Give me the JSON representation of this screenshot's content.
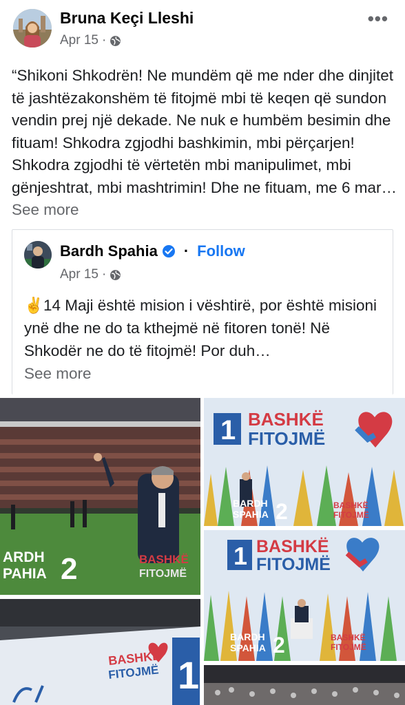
{
  "post": {
    "author": "Bruna Keçi Lleshi",
    "date": "Apr 15",
    "sep": "·",
    "more_icon": "•••",
    "text": "“Shikoni Shkodrën! Ne mundëm që me nder dhe dinjitet të jashtëzakonshëm të fitojmë mbi të keqen që sundon vendin prej një dekade. Ne nuk e humbëm besimin dhe fituam! Shkodra zgjodhi bashkimin, mbi përçarjen! Shkodra zgjodhi të vërtetën mbi manipulimet, mbi gënjeshtrat, mbi mashtrimin! Dhe ne fituam, me 6 mar… ",
    "see_more": "See more"
  },
  "shared": {
    "author": "Bardh Spahia",
    "dot": "·",
    "follow": "Follow",
    "date": "Apr 15",
    "sep": "·",
    "text": "✌️14 Maji është mision i vështirë, por është misioni ynë dhe ne do ta kthejmë në fitoren tonë! Në Shkodër ne do të fitojmë! Por duh…",
    "see_more": "See more"
  },
  "photos": {
    "campaign_name_1": "BARDH",
    "campaign_name_2": "SPAHIA",
    "campaign_number": "2",
    "slogan_1": "BASHKË",
    "slogan_2": "FITOJMË",
    "list_number": "1",
    "photo1_name_1": "ARDH",
    "photo1_name_2": "PAHIA",
    "photo1_slogan_1": "BASHKË",
    "photo1_slogan_2": "FITOJMË"
  },
  "colors": {
    "link_blue": "#1877f2",
    "meta_gray": "#65676b",
    "campaign_blue": "#2a5ea8",
    "campaign_red": "#d43b44"
  }
}
